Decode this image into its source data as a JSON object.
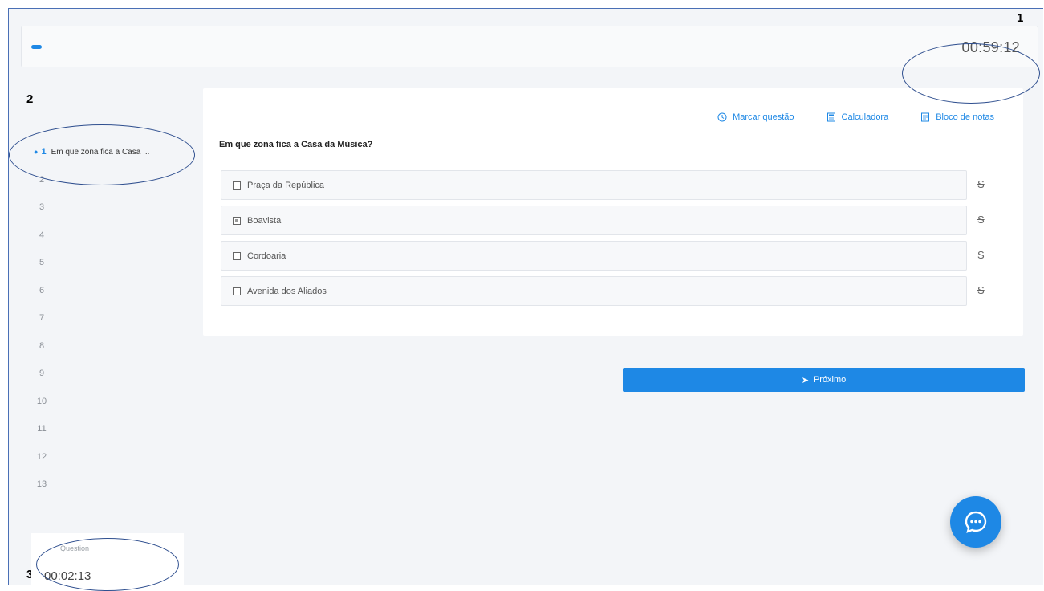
{
  "progress": {
    "fraction": 0.012
  },
  "timer": {
    "main": "00:59:12"
  },
  "annotations": {
    "one": "1",
    "two": "2",
    "three": "3"
  },
  "sidebar": {
    "active_title": "Em que zona fica a Casa ...",
    "items": [
      {
        "num": "1"
      },
      {
        "num": "2"
      },
      {
        "num": "3"
      },
      {
        "num": "4"
      },
      {
        "num": "5"
      },
      {
        "num": "6"
      },
      {
        "num": "7"
      },
      {
        "num": "8"
      },
      {
        "num": "9"
      },
      {
        "num": "10"
      },
      {
        "num": "11"
      },
      {
        "num": "12"
      },
      {
        "num": "13"
      }
    ]
  },
  "tools": {
    "mark": "Marcar questão",
    "calculator": "Calculadora",
    "notes": "Bloco de notas"
  },
  "question": {
    "text": "Em que zona fica a Casa da Música?",
    "options": [
      {
        "label": "Praça da República"
      },
      {
        "label": "Boavista"
      },
      {
        "label": "Cordoaria"
      },
      {
        "label": "Avenida dos Aliados"
      }
    ],
    "strike_symbol": "S"
  },
  "next_button": {
    "label": "Próximo"
  },
  "question_timer": {
    "label": "Question",
    "value": "00:02:13"
  },
  "colors": {
    "accent": "#1e88e5",
    "background": "#f3f5f8"
  },
  "icons": {
    "mark": "clock-icon",
    "calculator": "calculator-icon",
    "notes": "notepad-icon",
    "next": "arrow-icon",
    "chat": "chat-bubble-icon"
  }
}
